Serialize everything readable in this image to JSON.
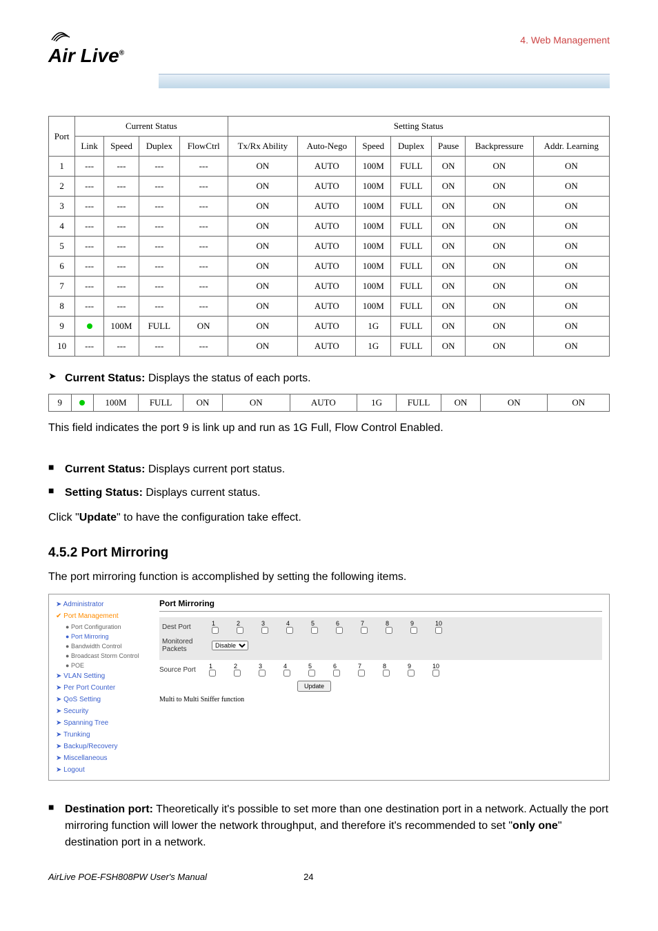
{
  "header": {
    "section": "4. Web Management",
    "logo_text": "Air Live",
    "reg": "®"
  },
  "table": {
    "group_top": [
      "Current Status",
      "Setting Status"
    ],
    "headers": [
      "Port",
      "Link",
      "Speed",
      "Duplex",
      "FlowCtrl",
      "Tx/Rx Ability",
      "Auto-Nego",
      "Speed",
      "Duplex",
      "Pause",
      "Backpressure",
      "Addr. Learning"
    ],
    "rows": [
      [
        "1",
        "---",
        "---",
        "---",
        "---",
        "ON",
        "AUTO",
        "100M",
        "FULL",
        "ON",
        "ON",
        "ON"
      ],
      [
        "2",
        "---",
        "---",
        "---",
        "---",
        "ON",
        "AUTO",
        "100M",
        "FULL",
        "ON",
        "ON",
        "ON"
      ],
      [
        "3",
        "---",
        "---",
        "---",
        "---",
        "ON",
        "AUTO",
        "100M",
        "FULL",
        "ON",
        "ON",
        "ON"
      ],
      [
        "4",
        "---",
        "---",
        "---",
        "---",
        "ON",
        "AUTO",
        "100M",
        "FULL",
        "ON",
        "ON",
        "ON"
      ],
      [
        "5",
        "---",
        "---",
        "---",
        "---",
        "ON",
        "AUTO",
        "100M",
        "FULL",
        "ON",
        "ON",
        "ON"
      ],
      [
        "6",
        "---",
        "---",
        "---",
        "---",
        "ON",
        "AUTO",
        "100M",
        "FULL",
        "ON",
        "ON",
        "ON"
      ],
      [
        "7",
        "---",
        "---",
        "---",
        "---",
        "ON",
        "AUTO",
        "100M",
        "FULL",
        "ON",
        "ON",
        "ON"
      ],
      [
        "8",
        "---",
        "---",
        "---",
        "---",
        "ON",
        "AUTO",
        "100M",
        "FULL",
        "ON",
        "ON",
        "ON"
      ],
      [
        "9",
        "●",
        "100M",
        "FULL",
        "ON",
        "ON",
        "AUTO",
        "1G",
        "FULL",
        "ON",
        "ON",
        "ON"
      ],
      [
        "10",
        "---",
        "---",
        "---",
        "---",
        "ON",
        "AUTO",
        "1G",
        "FULL",
        "ON",
        "ON",
        "ON"
      ]
    ]
  },
  "text": {
    "cs_line": " Displays the status of each ports.",
    "cs_bold": "Current Status:",
    "row9": [
      "9",
      "●",
      "100M",
      "FULL",
      "ON",
      "ON",
      "AUTO",
      "1G",
      "FULL",
      "ON",
      "ON",
      "ON"
    ],
    "row9_note": "This field indicates the port 9 is link up and run as 1G Full, Flow Control Enabled.",
    "b1_bold": "Current Status:",
    "b1_rest": " Displays current port status.",
    "b2_bold": "Setting Status:",
    "b2_rest": " Displays current status.",
    "click_pre": "Click \"",
    "click_bold": "Update",
    "click_post": "\" to have the configuration take effect.",
    "h3": "4.5.2 Port Mirroring",
    "pm_intro": "The port mirroring function is accomplished by setting the following items.",
    "dest_bold": "Destination port:",
    "dest_rest": " Theoretically it's possible to set more than one destination port in a network. Actually the port mirroring function will lower the network throughput, and therefore it's recommended to set \"",
    "dest_bold2": "only one",
    "dest_rest2": "\" destination port in a network."
  },
  "sidebar": {
    "items": [
      "Administrator",
      "Port Management",
      "VLAN Setting",
      "Per Port Counter",
      "QoS Setting",
      "Security",
      "Spanning Tree",
      "Trunking",
      "Backup/Recovery",
      "Miscellaneous",
      "Logout"
    ],
    "subs": [
      "Port Configuration",
      "Port Mirroring",
      "Bandwidth Control",
      "Broadcast Storm Control",
      "POE"
    ]
  },
  "panel": {
    "title": "Port Mirroring",
    "dest_label": "Dest Port",
    "mon_label": "Monitored Packets",
    "mon_value": "Disable",
    "src_label": "Source Port",
    "update_btn": "Update",
    "note": "Multi to Multi Sniffer function",
    "ports": [
      "1",
      "2",
      "3",
      "4",
      "5",
      "6",
      "7",
      "8",
      "9",
      "10"
    ]
  },
  "footer": {
    "manual": "AirLive POE-FSH808PW User's Manual",
    "page": "24"
  }
}
